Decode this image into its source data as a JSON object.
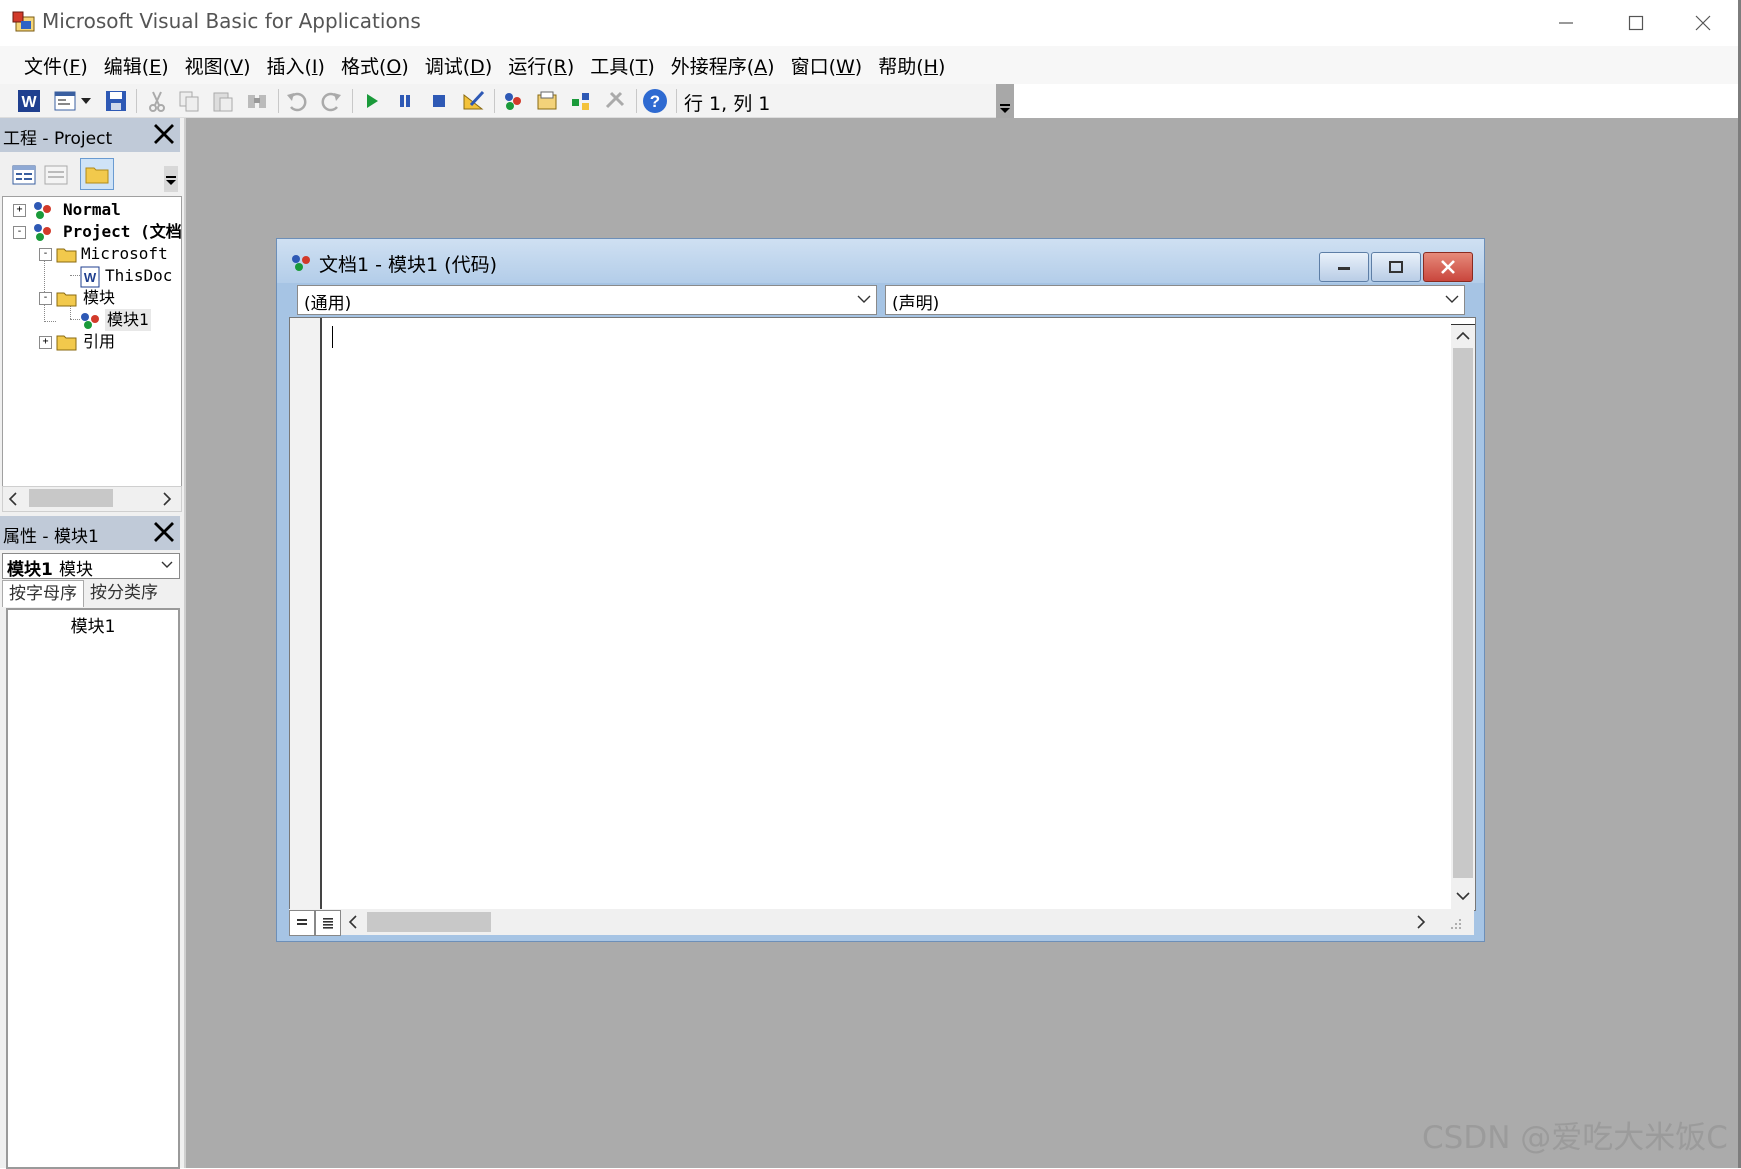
{
  "window": {
    "title": "Microsoft Visual Basic for Applications",
    "controls": [
      "minimize",
      "maximize",
      "close"
    ]
  },
  "menu": [
    {
      "label": "文件(F)",
      "base": "文件(",
      "key": "F",
      "tail": ")"
    },
    {
      "label": "编辑(E)",
      "base": "编辑(",
      "key": "E",
      "tail": ")"
    },
    {
      "label": "视图(V)",
      "base": "视图(",
      "key": "V",
      "tail": ")"
    },
    {
      "label": "插入(I)",
      "base": "插入(",
      "key": "I",
      "tail": ")"
    },
    {
      "label": "格式(O)",
      "base": "格式(",
      "key": "O",
      "tail": ")"
    },
    {
      "label": "调试(D)",
      "base": "调试(",
      "key": "D",
      "tail": ")"
    },
    {
      "label": "运行(R)",
      "base": "运行(",
      "key": "R",
      "tail": ")"
    },
    {
      "label": "工具(T)",
      "base": "工具(",
      "key": "T",
      "tail": ")"
    },
    {
      "label": "外接程序(A)",
      "base": "外接程序(",
      "key": "A",
      "tail": ")"
    },
    {
      "label": "窗口(W)",
      "base": "窗口(",
      "key": "W",
      "tail": ")"
    },
    {
      "label": "帮助(H)",
      "base": "帮助(",
      "key": "H",
      "tail": ")"
    }
  ],
  "toolbar": {
    "cursor_position": "行 1, 列 1",
    "icons": [
      "word-icon",
      "insert-userform-icon",
      "dropdown-arrow-icon",
      "save-icon",
      "cut-icon",
      "copy-icon",
      "paste-icon",
      "find-icon",
      "undo-icon",
      "redo-icon",
      "run-icon",
      "break-icon",
      "reset-icon",
      "design-mode-icon",
      "project-explorer-icon",
      "properties-window-icon",
      "object-browser-icon",
      "toolbox-icon",
      "help-icon"
    ]
  },
  "project_panel": {
    "title": "工程 - Project",
    "tree": [
      {
        "label": "Normal",
        "level": 0,
        "bold": true,
        "expand": "+"
      },
      {
        "label": "Project (文档",
        "level": 0,
        "bold": true,
        "expand": "-"
      },
      {
        "label": "Microsoft",
        "level": 1,
        "expand": "-"
      },
      {
        "label": "ThisDoc",
        "level": 2
      },
      {
        "label": "模块",
        "level": 1,
        "expand": "-"
      },
      {
        "label": "模块1",
        "level": 2,
        "selected": true
      },
      {
        "label": "引用",
        "level": 1,
        "expand": "+"
      }
    ]
  },
  "properties_panel": {
    "title": "属性 - 模块1",
    "object_name": "模块1",
    "object_type": "模块",
    "tabs": [
      "按字母序",
      "按分类序"
    ],
    "name_value": "模块1"
  },
  "code_window": {
    "title": "文档1 - 模块1 (代码)",
    "object_combo": "(通用)",
    "procedure_combo": "(声明)"
  },
  "watermark": "CSDN @爱吃大米饭C",
  "colors": {
    "workspace": "#ababab",
    "panel_header": "#c0cad8",
    "codewin_frame": "#a6c4e4",
    "close_button": "#c9463d"
  }
}
